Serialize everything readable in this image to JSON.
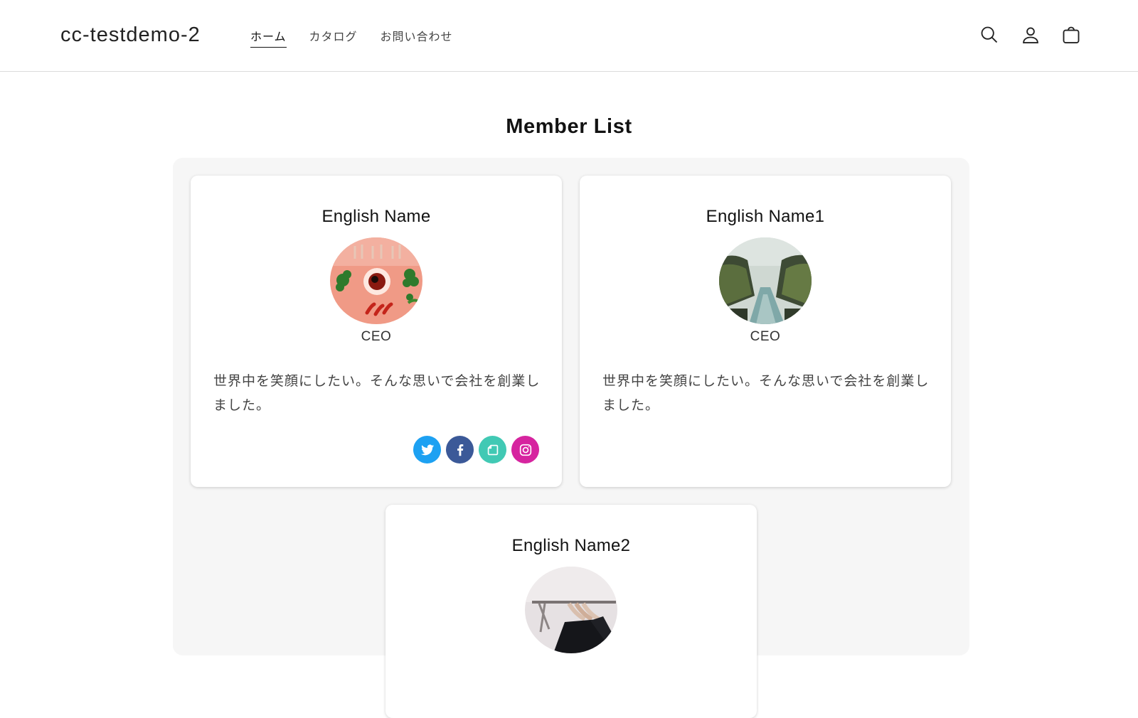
{
  "header": {
    "logo": "cc-testdemo-2",
    "nav": [
      {
        "label": "ホーム",
        "active": true
      },
      {
        "label": "カタログ",
        "active": false
      },
      {
        "label": "お問い合わせ",
        "active": false
      }
    ],
    "icons": [
      "search-icon",
      "account-icon",
      "cart-icon"
    ]
  },
  "main": {
    "title": "Member List",
    "members": [
      {
        "name": "English Name",
        "role": "CEO",
        "bio": "世界中を笑顔にしたい。そんな思いで会社を創業しました。",
        "avatar": "chili-bowl-photo",
        "social": [
          {
            "icon": "twitter-icon",
            "color": "#1da1f2"
          },
          {
            "icon": "facebook-icon",
            "color": "#3b5998"
          },
          {
            "icon": "note-icon",
            "color": "#41c9b4"
          },
          {
            "icon": "instagram-icon",
            "color": "#d6249f"
          }
        ]
      },
      {
        "name": "English Name1",
        "role": "CEO",
        "bio": "世界中を笑顔にしたい。そんな思いで会社を創業しました。",
        "avatar": "canyon-river-photo",
        "social": []
      },
      {
        "name": "English Name2",
        "role": "",
        "bio": "",
        "avatar": "clothing-rack-photo",
        "social": []
      }
    ]
  }
}
